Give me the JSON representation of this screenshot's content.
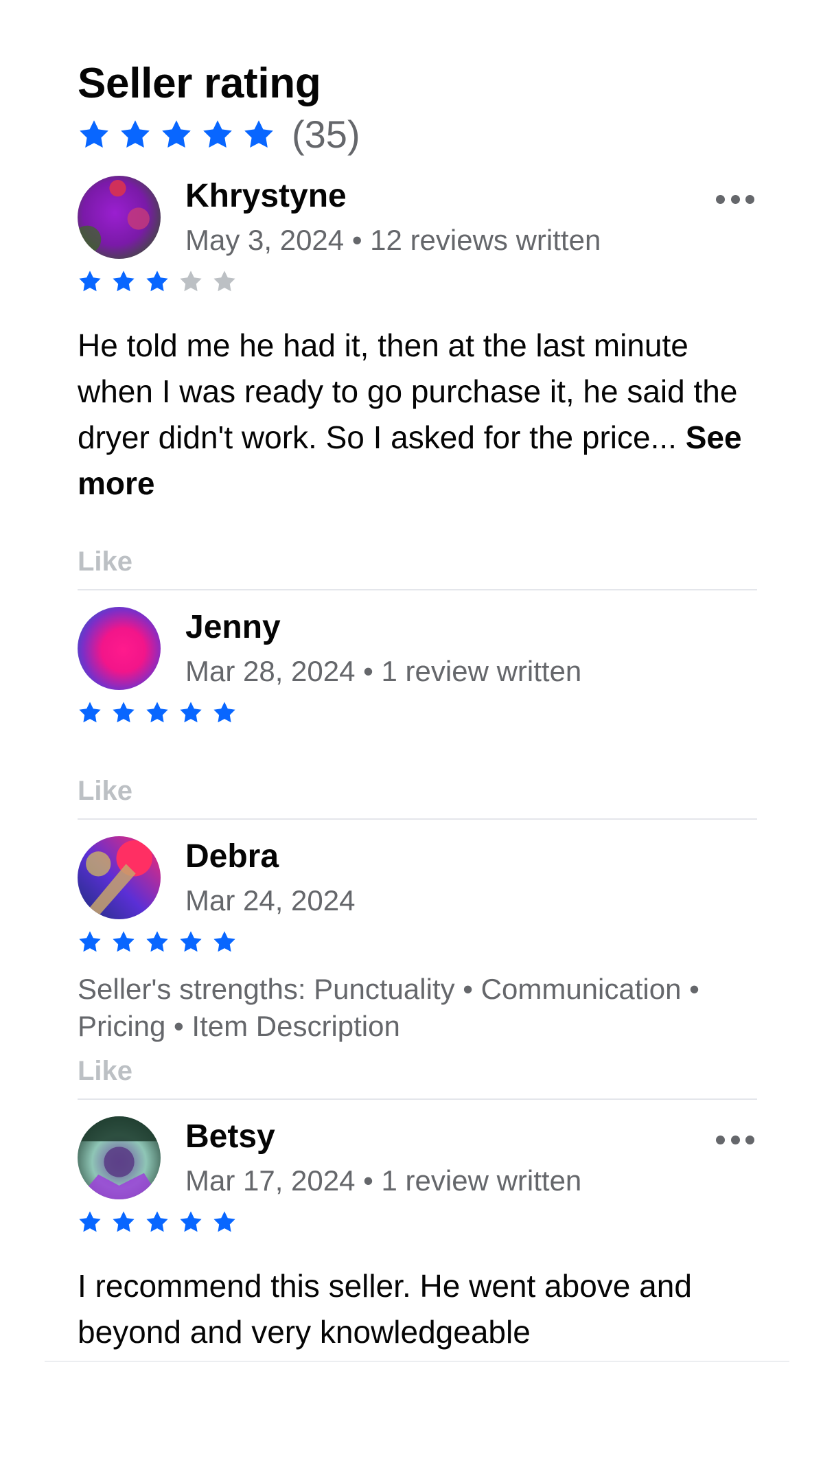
{
  "header": {
    "title": "Seller rating",
    "rating_stars": 5,
    "rating_count": "(35)"
  },
  "colors": {
    "star_filled": "#0866ff",
    "star_empty": "#bcc0c4",
    "meta_text": "#65676b",
    "like_text": "#bcc0c4",
    "divider": "#e4e6eb"
  },
  "reviews": [
    {
      "name": "Khrystyne",
      "meta": "May 3, 2024 • 12 reviews written",
      "rating": 3,
      "text": "He told me he had it, then at the last minute when I was ready to go purchase it, he said the dryer didn't work. So I asked for the price... ",
      "see_more": "See more",
      "like": "Like",
      "avatar_icon": "avatar-icon"
    },
    {
      "name": "Jenny",
      "meta": "Mar 28, 2024 • 1 review written",
      "rating": 5,
      "like": "Like",
      "avatar_icon": "avatar-icon"
    },
    {
      "name": "Debra",
      "meta": "Mar 24, 2024",
      "rating": 5,
      "strengths": "Seller's strengths: Punctuality • Communication • Pricing • Item Description",
      "like": "Like",
      "avatar_icon": "avatar-icon"
    },
    {
      "name": "Betsy",
      "meta": "Mar 17, 2024 • 1 review written",
      "rating": 5,
      "text": "I recommend this seller. He went above and beyond and very knowledgeable",
      "avatar_icon": "avatar-icon"
    }
  ]
}
